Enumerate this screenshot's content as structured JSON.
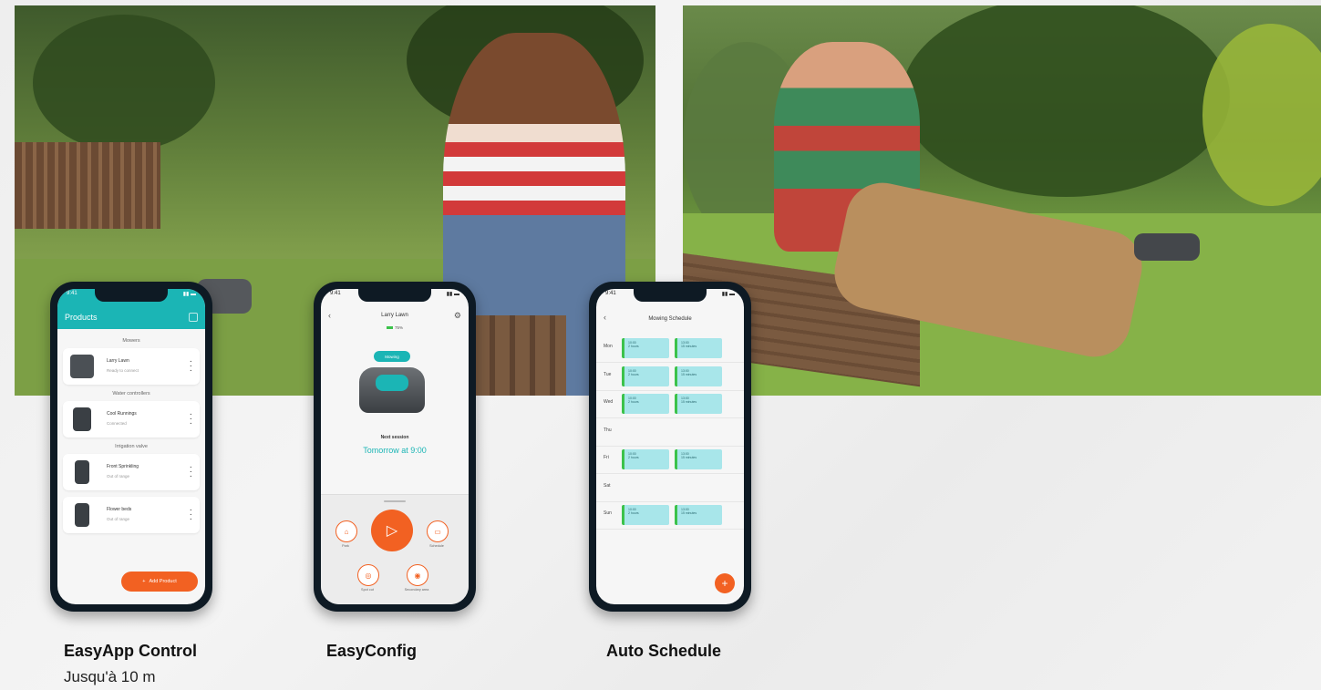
{
  "photos": {
    "left": {
      "alt": "Woman in striped shirt using smartphone in garden"
    },
    "right": {
      "alt": "Man sitting on deck controlling robotic mower with phone"
    }
  },
  "phone1": {
    "time": "9:41",
    "title": "Products",
    "sections": [
      {
        "label": "Mowers",
        "items": [
          {
            "name": "Larry Lawn",
            "status": "Ready to connect"
          }
        ]
      },
      {
        "label": "Water controllers",
        "items": [
          {
            "name": "Cool Runnings",
            "status": "Connected"
          }
        ]
      },
      {
        "label": "Irrigation valve",
        "items": [
          {
            "name": "Front Sprinkling",
            "status": "Out of range"
          },
          {
            "name": "Flower beds",
            "status": "Out of range"
          }
        ]
      }
    ],
    "add_button": "Add Product"
  },
  "phone2": {
    "time": "9:41",
    "mower_name": "Larry Lawn",
    "battery": "75%",
    "status_bubble": "Mowing",
    "next_session_label": "Next session",
    "next_session_value": "Tomorrow at 9:00",
    "buttons": {
      "park": "Park",
      "schedule": "Schedule",
      "spot": "Spot cut",
      "secondary": "Secondary area"
    }
  },
  "phone3": {
    "time": "9:41",
    "title": "Mowing Schedule",
    "days": [
      {
        "day": "Mon",
        "slots": [
          {
            "time": "10:00",
            "dur": "2 hours"
          },
          {
            "time": "13:00",
            "dur": "15 minutes"
          }
        ]
      },
      {
        "day": "Tue",
        "slots": [
          {
            "time": "10:00",
            "dur": "2 hours"
          },
          {
            "time": "13:00",
            "dur": "15 minutes"
          }
        ]
      },
      {
        "day": "Wed",
        "slots": [
          {
            "time": "10:00",
            "dur": "2 hours"
          },
          {
            "time": "13:00",
            "dur": "15 minutes"
          }
        ]
      },
      {
        "day": "Thu",
        "slots": []
      },
      {
        "day": "Fri",
        "slots": [
          {
            "time": "10:00",
            "dur": "2 hours"
          },
          {
            "time": "13:00",
            "dur": "15 minutes"
          }
        ]
      },
      {
        "day": "Sat",
        "slots": []
      },
      {
        "day": "Sun",
        "slots": [
          {
            "time": "10:00",
            "dur": "2 hours"
          },
          {
            "time": "13:00",
            "dur": "15 minutes"
          }
        ]
      }
    ]
  },
  "captions": {
    "c1_title": "EasyApp Control",
    "c1_sub": "Jusqu'à 10 m",
    "c2_title": "EasyConfig",
    "c3_title": "Auto Schedule"
  },
  "colors": {
    "accent": "#f26122",
    "teal": "#1bb5b5"
  }
}
